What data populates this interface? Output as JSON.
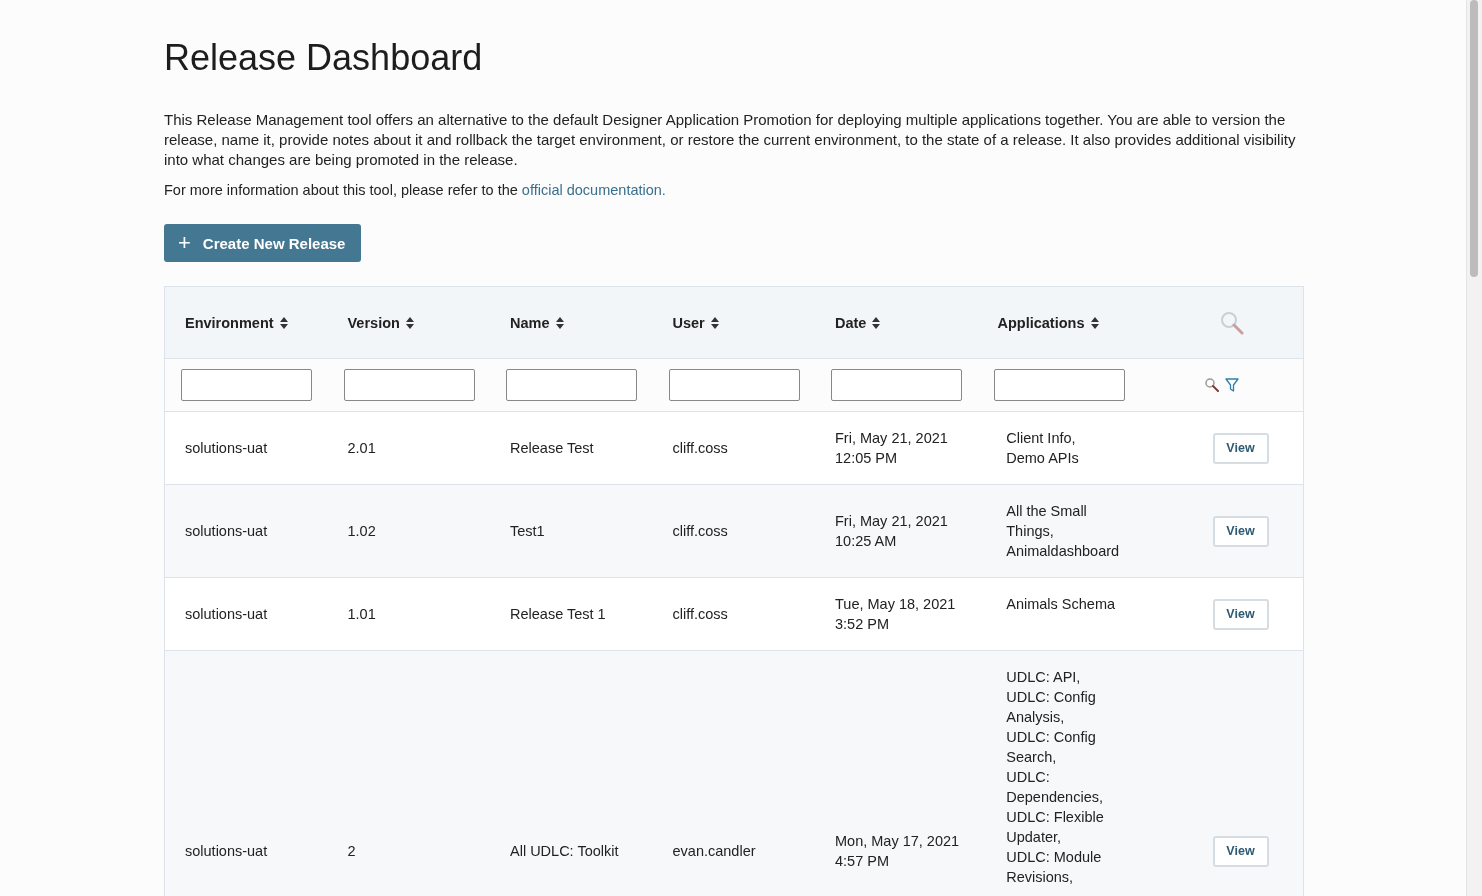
{
  "title": "Release Dashboard",
  "intro": "This Release Management tool offers an alternative to the default Designer Application Promotion for deploying multiple applications together. You are able to version the release, name it, provide notes about it and rollback the target environment, or restore the current environment, to the state of a release. It also provides additional visibility into what changes are being promoted in the release.",
  "info": {
    "text": "For more information about this tool, please refer to the",
    "link": "official documentation."
  },
  "create_button": {
    "icon": "+",
    "label": "Create New Release"
  },
  "table": {
    "columns": [
      "Environment",
      "Version",
      "Name",
      "User",
      "Date",
      "Applications"
    ],
    "rows": [
      {
        "environment": "solutions-uat",
        "version": "2.01",
        "name": "Release Test",
        "user": "cliff.coss",
        "date": [
          "Fri, May 21, 2021",
          "12:05 PM"
        ],
        "applications": [
          "Client Info,",
          "Demo APIs"
        ],
        "action": "View"
      },
      {
        "environment": "solutions-uat",
        "version": "1.02",
        "name": "Test1",
        "user": "cliff.coss",
        "date": [
          "Fri, May 21, 2021",
          "10:25 AM"
        ],
        "applications": [
          "All the Small Things,",
          "Animaldashboard"
        ],
        "action": "View"
      },
      {
        "environment": "solutions-uat",
        "version": "1.01",
        "name": "Release Test 1",
        "user": "cliff.coss",
        "date": [
          "Tue, May 18, 2021",
          "3:52 PM"
        ],
        "applications": [
          "Animals Schema"
        ],
        "action": "View"
      },
      {
        "environment": "solutions-uat",
        "version": "2",
        "name": "All UDLC: Toolkit",
        "user": "evan.candler",
        "date": [
          "Mon, May 17, 2021",
          "4:57 PM"
        ],
        "applications": [
          "UDLC: API,",
          "UDLC: Config Analysis,",
          "UDLC: Config Search,",
          "UDLC: Dependencies,",
          "UDLC: Flexible Updater,",
          "UDLC: Module Revisions,"
        ],
        "action": "View"
      }
    ]
  }
}
